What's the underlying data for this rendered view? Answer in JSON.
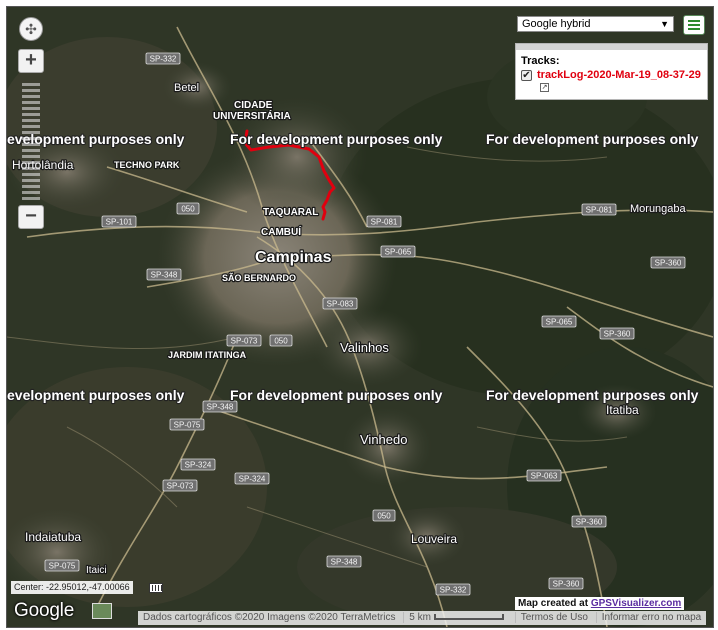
{
  "watermark": "For development purposes only",
  "watermark_clipped": "evelopment purposes only",
  "map_type": {
    "selected": "Google hybrid"
  },
  "tracks_panel": {
    "title": "Tracks:",
    "track": {
      "name": "trackLog-2020-Mar-19_08-37-29",
      "color": "#e0000f",
      "checked": true
    }
  },
  "place_labels": {
    "campinas": "Campinas",
    "valinhos": "Valinhos",
    "vinhedo": "Vinhedo",
    "louveira": "Louveira",
    "itatiba": "Itatiba",
    "indaiatuba": "Indaiatuba",
    "hortolandia": "Hortolândia",
    "betel": "Betel",
    "morungaba": "Morungaba",
    "itaici": "Itaici",
    "taquaral": "TAQUARAL",
    "cambui": "CAMBUÍ",
    "sao_bernardo": "SÃO BERNARDO",
    "jardim_itatinga": "JARDIM ITATINGA",
    "techno_park": "TECHNO PARK",
    "cidade_universitaria_1": "CIDADE",
    "cidade_universitaria_2": "UNIVERSITÁRIA"
  },
  "road_labels": {
    "sp332_n": "SP-332",
    "sp101": "SP-101",
    "r050_a": "050",
    "sp348_w": "SP-348",
    "sp081_c": "SP-081",
    "sp065_c": "SP-065",
    "sp083": "SP-083",
    "sp073_a": "SP-073",
    "r050_b": "050",
    "sp348_s": "SP-348",
    "sp075": "SP-075",
    "sp324_a": "SP-324",
    "sp073_b": "SP-073",
    "sp324_b": "SP-324",
    "sp081_e": "SP-081",
    "sp360_a": "SP-360",
    "sp065_e": "SP-065",
    "sp360_b": "SP-360",
    "sp063": "SP-063",
    "r050_c": "050",
    "sp360_c": "SP-360",
    "sp348_se": "SP-348",
    "sp332_s": "SP-332",
    "sp360_d": "SP-360",
    "sp075_s": "SP-075"
  },
  "center_readout": "Center: -22.95012,-47.00066",
  "google_logo": "Google",
  "attribution": {
    "data": "Dados cartográficos ©2020 Imagens ©2020 TerraMetrics",
    "scale": "5 km",
    "terms": "Termos de Uso",
    "report": "Informar erro no mapa"
  },
  "map_created": {
    "prefix": "Map created at",
    "site": "GPSVisualizer.com"
  },
  "icons": [
    "compass-icon",
    "zoom-in-icon",
    "zoom-out-icon",
    "menu-icon",
    "external-link-icon",
    "grid-icon",
    "satellite-thumbnail-icon"
  ]
}
